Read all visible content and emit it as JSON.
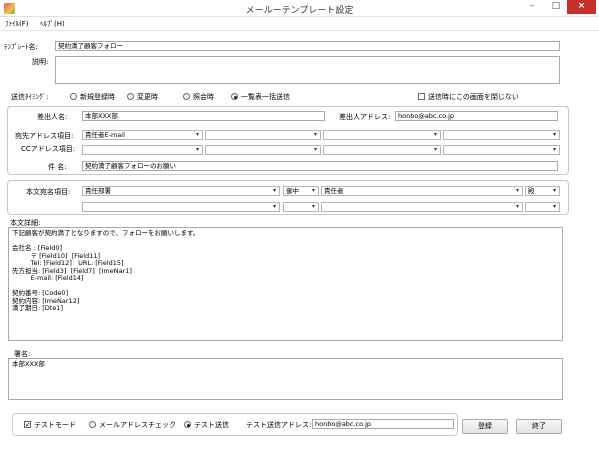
{
  "window": {
    "title": "メールーテンプレート設定",
    "min": "–",
    "max": "□",
    "close": "×"
  },
  "menu": {
    "file": "ﾌｧｲﾙ(F)",
    "help": "ﾍﾙﾌﾟ(H)"
  },
  "template_name": {
    "label": "ﾃﾝﾌﾟﾚｰﾄ名:",
    "value": "契約満了顧客フォロー"
  },
  "description": {
    "label": "説明:",
    "value": ""
  },
  "send_timing": {
    "label": "送信ﾀｲﾐﾝｸﾞ:",
    "options": [
      "新規登録時",
      "変更時",
      "照会時",
      "一覧表一括送信"
    ],
    "selected": "一覧表一括送信",
    "keep_open_label": "送信時にこの画面を閉じない",
    "keep_open_checked": false
  },
  "sender": {
    "name_label": "差出人名:",
    "name_value": "本部XXX部",
    "address_label": "差出人アドレス:",
    "address_value": "honbo@abc.co.jp"
  },
  "recipient": {
    "to_label": "宛先アドレス項目:",
    "to_value": "責任者E-mail",
    "cc_label": "CCアドレス項目:"
  },
  "subject": {
    "label": "件 名:",
    "value": "契約満了顧客フォローのお願い"
  },
  "body_name": {
    "label": "本文宛名項目:",
    "field1": "責任部署",
    "honorific1": "御中",
    "field2": "責任者",
    "honorific2": "殿"
  },
  "body_detail": {
    "label": "本文詳細:",
    "text": "下記顧客が契約満了となりますので、フォローをお願いします。\n\n会社名 : [Field0]\n         〒 [Field10]  [Field11]\n         Tel: [Field12]   URL: [Field15]\n先方担当: [Field3]  [Field7]  [ImeNar1]\n         E-mail: [Field14]\n\n契約番号: [Code0]\n契約内容: [ImeNar12]\n満了期日: [Dte1]"
  },
  "signature": {
    "label": "署名:",
    "value": "本部XXX部"
  },
  "footer": {
    "test_mode_label": "テストモード",
    "test_mode_checked": true,
    "options": [
      "メールアドレスチェック",
      "テスト送信"
    ],
    "selected": "テスト送信",
    "test_address_label": "テスト送信アドレス:",
    "test_address_value": "honbo@abc.co.jp",
    "register_button": "登録",
    "close_button": "終了"
  }
}
